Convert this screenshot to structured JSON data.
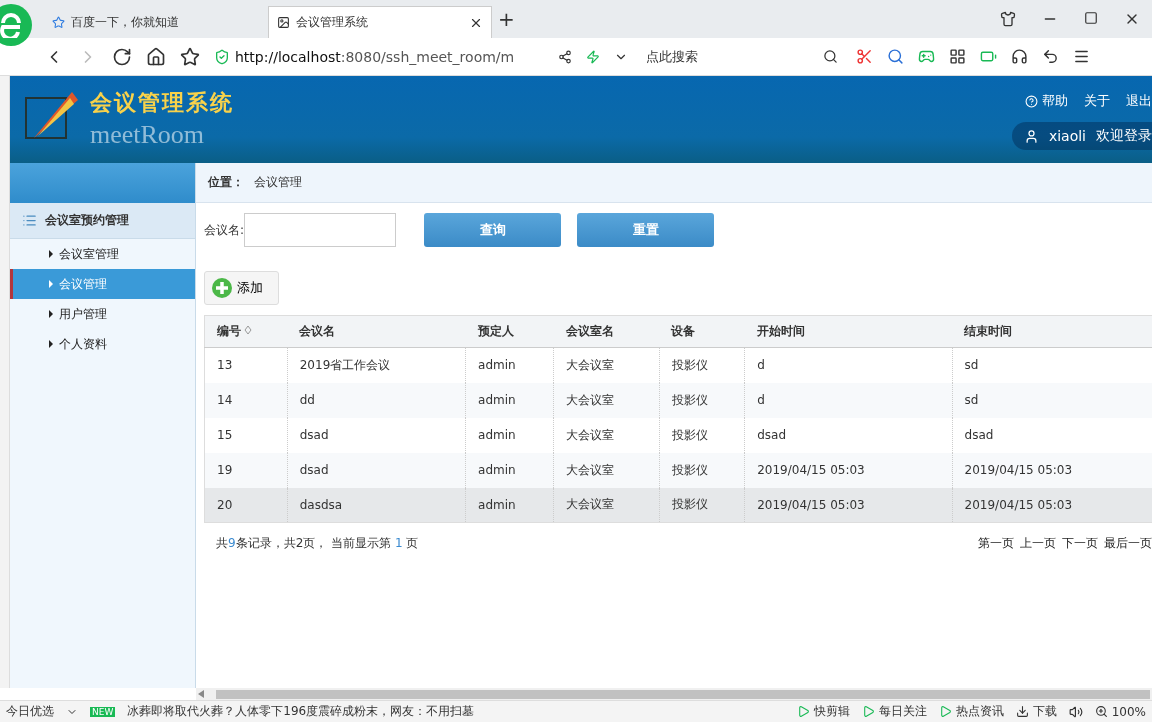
{
  "browser": {
    "tabs": [
      {
        "label": "百度一下，你就知道",
        "selected": false
      },
      {
        "label": "会议管理系统",
        "selected": true
      }
    ],
    "new_tab": "+",
    "url_host": "http://localhost",
    "url_rest": ":8080/ssh_meet_room/m",
    "search_placeholder": "点此搜索"
  },
  "header": {
    "title": "会议管理系统",
    "subtitle": "meetRoom",
    "links": [
      "帮助",
      "关于",
      "退出"
    ],
    "user": "xiaoli",
    "welcome": "欢迎登录"
  },
  "breadcrumb": {
    "label": "位置：",
    "value": "会议管理"
  },
  "sidebar": {
    "group": "会议室预约管理",
    "items": [
      {
        "label": "会议室管理",
        "selected": false
      },
      {
        "label": "会议管理",
        "selected": true
      },
      {
        "label": "用户管理",
        "selected": false
      },
      {
        "label": "个人资料",
        "selected": false
      }
    ]
  },
  "filter": {
    "label": "会议名:",
    "search_button": "查询",
    "reset_button": "重置"
  },
  "add_button": "添加",
  "table": {
    "columns": [
      "编号",
      "会议名",
      "预定人",
      "会议室名",
      "设备",
      "开始时间",
      "结束时间"
    ],
    "rows": [
      {
        "selected": false,
        "cells": [
          "13",
          "2019省工作会议",
          "admin",
          "大会议室",
          "投影仪",
          "d",
          "sd"
        ]
      },
      {
        "selected": false,
        "cells": [
          "14",
          "dd",
          "admin",
          "大会议室",
          "投影仪",
          "d",
          "sd"
        ]
      },
      {
        "selected": false,
        "cells": [
          "15",
          "dsad",
          "admin",
          "大会议室",
          "投影仪",
          "dsad",
          "dsad"
        ]
      },
      {
        "selected": false,
        "cells": [
          "19",
          "dsad",
          "admin",
          "大会议室",
          "投影仪",
          "2019/04/15 05:03",
          "2019/04/15 05:03"
        ]
      },
      {
        "selected": true,
        "cells": [
          "20",
          "dasdsa",
          "admin",
          "大会议室",
          "投影仪",
          "2019/04/15 05:03",
          "2019/04/15 05:03"
        ]
      }
    ]
  },
  "pagination": {
    "summary": [
      {
        "text": "共",
        "highlight": false
      },
      {
        "text": "9",
        "highlight": true
      },
      {
        "text": "条记录，共2页， 当前显示第 ",
        "highlight": false
      },
      {
        "text": "1",
        "highlight": true
      },
      {
        "text": " 页",
        "highlight": false
      }
    ],
    "links": [
      "第一页",
      "上一页",
      "下一页",
      "最后一页"
    ]
  },
  "status_bar": {
    "left": "今日优选",
    "badge": "NEW",
    "news": "冰葬即将取代火葬？人体零下196度震碎成粉末，网友：不用扫墓",
    "items": [
      "快剪辑",
      "每日关注",
      "热点资讯",
      "下载"
    ],
    "zoom": "100%"
  }
}
